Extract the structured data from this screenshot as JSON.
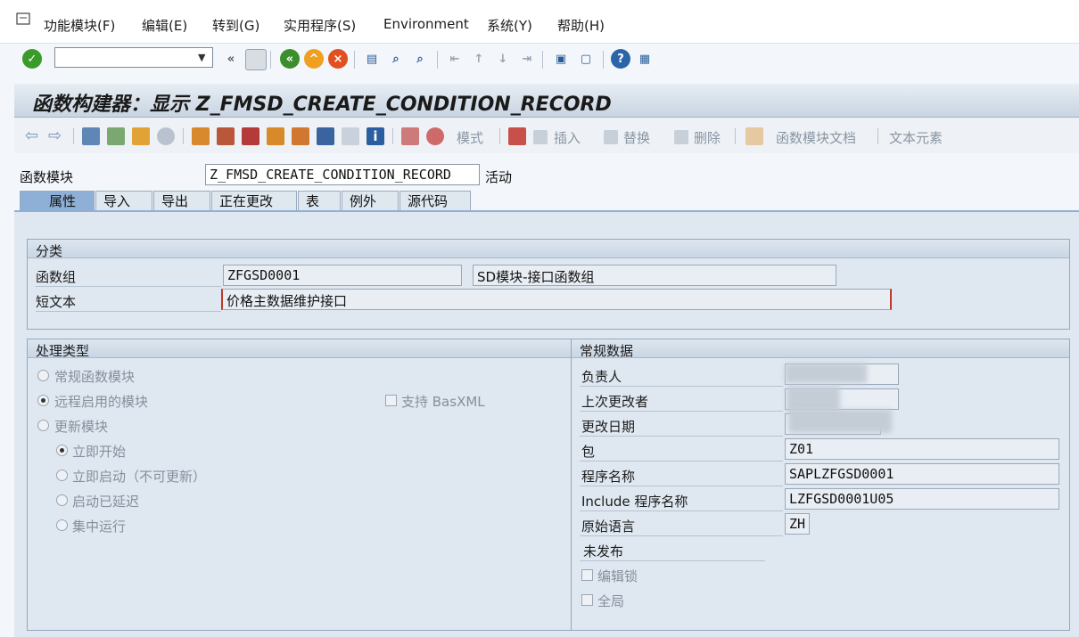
{
  "menu": {
    "items": [
      "功能模块(F)",
      "编辑(E)",
      "转到(G)",
      "实用程序(S)",
      "Environment",
      "系统(Y)",
      "帮助(H)"
    ]
  },
  "title": "函数构建器：显示 Z_FMSD_CREATE_CONDITION_RECORD",
  "app_toolbar": {
    "mode_label": "模式",
    "insert_label": "插入",
    "replace_label": "替换",
    "delete_label": "删除",
    "doc_label": "函数模块文档",
    "text_elements_label": "文本元素"
  },
  "function_module": {
    "label": "函数模块",
    "value": "Z_FMSD_CREATE_CONDITION_RECORD",
    "status": "活动"
  },
  "tabs": [
    "属性",
    "导入",
    "导出",
    "正在更改",
    "表",
    "例外",
    "源代码"
  ],
  "classification": {
    "heading": "分类",
    "function_group_label": "函数组",
    "function_group_value": "ZFGSD0001",
    "function_group_desc": "SD模块-接口函数组",
    "short_text_label": "短文本",
    "short_text_value": "价格主数据维护接口"
  },
  "processing_type": {
    "heading": "处理类型",
    "normal": "常规函数模块",
    "remote": "远程启用的模块",
    "basxml": "支持 BasXML",
    "update": "更新模块",
    "start_immediately": "立即开始",
    "start_immediately_no_update": "立即启动（不可更新）",
    "start_delayed": "启动已延迟",
    "collective_run": "集中运行"
  },
  "general_data": {
    "heading": "常规数据",
    "responsible_label": "负责人",
    "last_changed_by_label": "上次更改者",
    "changed_on_label": "更改日期",
    "package_label": "包",
    "package_value": "Z01",
    "program_name_label": "程序名称",
    "program_name_value": "SAPLZFGSD0001",
    "include_label": "Include 程序名称",
    "include_value": "LZFGSD0001U05",
    "orig_lang_label": "原始语言",
    "orig_lang_value": "ZH",
    "not_released": "未发布",
    "edit_lock": "编辑锁",
    "global": "全局"
  }
}
